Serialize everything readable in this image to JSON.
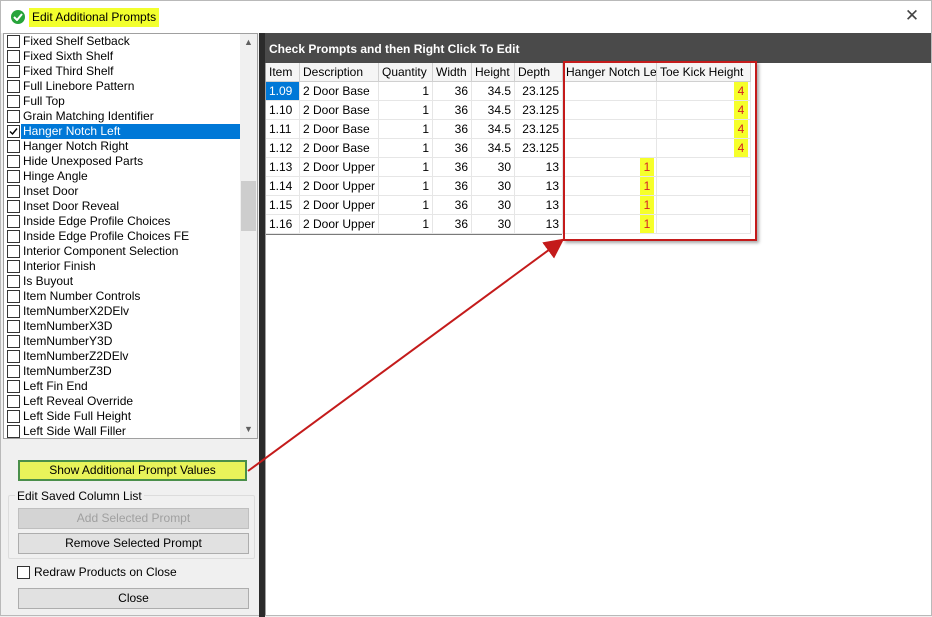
{
  "window": {
    "title": "Edit Additional Prompts",
    "close_glyph": "✕",
    "title_icon": "check-circle-icon",
    "title_highlight": "#f2ff2d"
  },
  "prompt_list": {
    "items": [
      {
        "label": "Fixed Shelf Setback",
        "checked": false,
        "selected": false
      },
      {
        "label": "Fixed Sixth Shelf",
        "checked": false,
        "selected": false
      },
      {
        "label": "Fixed Third Shelf",
        "checked": false,
        "selected": false
      },
      {
        "label": "Full Linebore Pattern",
        "checked": false,
        "selected": false
      },
      {
        "label": "Full Top",
        "checked": false,
        "selected": false
      },
      {
        "label": "Grain Matching Identifier",
        "checked": false,
        "selected": false
      },
      {
        "label": "Hanger Notch Left",
        "checked": true,
        "selected": true
      },
      {
        "label": "Hanger Notch Right",
        "checked": false,
        "selected": false
      },
      {
        "label": "Hide Unexposed Parts",
        "checked": false,
        "selected": false
      },
      {
        "label": "Hinge Angle",
        "checked": false,
        "selected": false
      },
      {
        "label": "Inset Door",
        "checked": false,
        "selected": false
      },
      {
        "label": "Inset Door Reveal",
        "checked": false,
        "selected": false
      },
      {
        "label": "Inside Edge Profile Choices",
        "checked": false,
        "selected": false
      },
      {
        "label": "Inside Edge Profile Choices FE",
        "checked": false,
        "selected": false
      },
      {
        "label": "Interior Component Selection",
        "checked": false,
        "selected": false
      },
      {
        "label": "Interior Finish",
        "checked": false,
        "selected": false
      },
      {
        "label": "Is Buyout",
        "checked": false,
        "selected": false
      },
      {
        "label": "Item Number Controls",
        "checked": false,
        "selected": false
      },
      {
        "label": "ItemNumberX2DElv",
        "checked": false,
        "selected": false
      },
      {
        "label": "ItemNumberX3D",
        "checked": false,
        "selected": false
      },
      {
        "label": "ItemNumberY3D",
        "checked": false,
        "selected": false
      },
      {
        "label": "ItemNumberZ2DElv",
        "checked": false,
        "selected": false
      },
      {
        "label": "ItemNumberZ3D",
        "checked": false,
        "selected": false
      },
      {
        "label": "Left Fin End",
        "checked": false,
        "selected": false
      },
      {
        "label": "Left Reveal Override",
        "checked": false,
        "selected": false
      },
      {
        "label": "Left Side Full Height",
        "checked": false,
        "selected": false
      },
      {
        "label": "Left Side Wall Filler",
        "checked": false,
        "selected": false
      }
    ],
    "scroll_up_glyph": "▲",
    "scroll_down_glyph": "▼"
  },
  "buttons": {
    "show_values": "Show Additional Prompt Values",
    "add_selected": "Add Selected Prompt",
    "remove_selected": "Remove Selected Prompt",
    "close": "Close"
  },
  "saved_column_group": {
    "label": "Edit Saved Column List"
  },
  "redraw": {
    "label": "Redraw Products on Close",
    "checked": false
  },
  "grid": {
    "header_title": "Check Prompts and then Right Click To Edit",
    "columns": [
      "Item",
      "Description",
      "Quantity",
      "Width",
      "Height",
      "Depth",
      "Hanger Notch Lef",
      "Toe Kick Height"
    ],
    "rows": [
      {
        "item": "1.09",
        "description": "2 Door Base",
        "quantity": "1",
        "width": "36",
        "height": "34.5",
        "depth": "23.125",
        "hanger_notch_left": "",
        "toe_kick_height": "4",
        "selected": true
      },
      {
        "item": "1.10",
        "description": "2 Door Base",
        "quantity": "1",
        "width": "36",
        "height": "34.5",
        "depth": "23.125",
        "hanger_notch_left": "",
        "toe_kick_height": "4",
        "selected": false
      },
      {
        "item": "1.11",
        "description": "2 Door Base",
        "quantity": "1",
        "width": "36",
        "height": "34.5",
        "depth": "23.125",
        "hanger_notch_left": "",
        "toe_kick_height": "4",
        "selected": false
      },
      {
        "item": "1.12",
        "description": "2 Door Base",
        "quantity": "1",
        "width": "36",
        "height": "34.5",
        "depth": "23.125",
        "hanger_notch_left": "",
        "toe_kick_height": "4",
        "selected": false
      },
      {
        "item": "1.13",
        "description": "2 Door Upper",
        "quantity": "1",
        "width": "36",
        "height": "30",
        "depth": "13",
        "hanger_notch_left": "1",
        "toe_kick_height": "",
        "selected": false
      },
      {
        "item": "1.14",
        "description": "2 Door Upper",
        "quantity": "1",
        "width": "36",
        "height": "30",
        "depth": "13",
        "hanger_notch_left": "1",
        "toe_kick_height": "",
        "selected": false
      },
      {
        "item": "1.15",
        "description": "2 Door Upper",
        "quantity": "1",
        "width": "36",
        "height": "30",
        "depth": "13",
        "hanger_notch_left": "1",
        "toe_kick_height": "",
        "selected": false
      },
      {
        "item": "1.16",
        "description": "2 Door Upper",
        "quantity": "1",
        "width": "36",
        "height": "30",
        "depth": "13",
        "hanger_notch_left": "1",
        "toe_kick_height": "",
        "selected": false
      }
    ]
  },
  "colors": {
    "selection_blue": "#0078d7",
    "highlight_yellow": "#f6ff2b",
    "value_red": "#d32424",
    "annotation_red": "#c41b1b",
    "header_dark": "#4a4a4a"
  }
}
